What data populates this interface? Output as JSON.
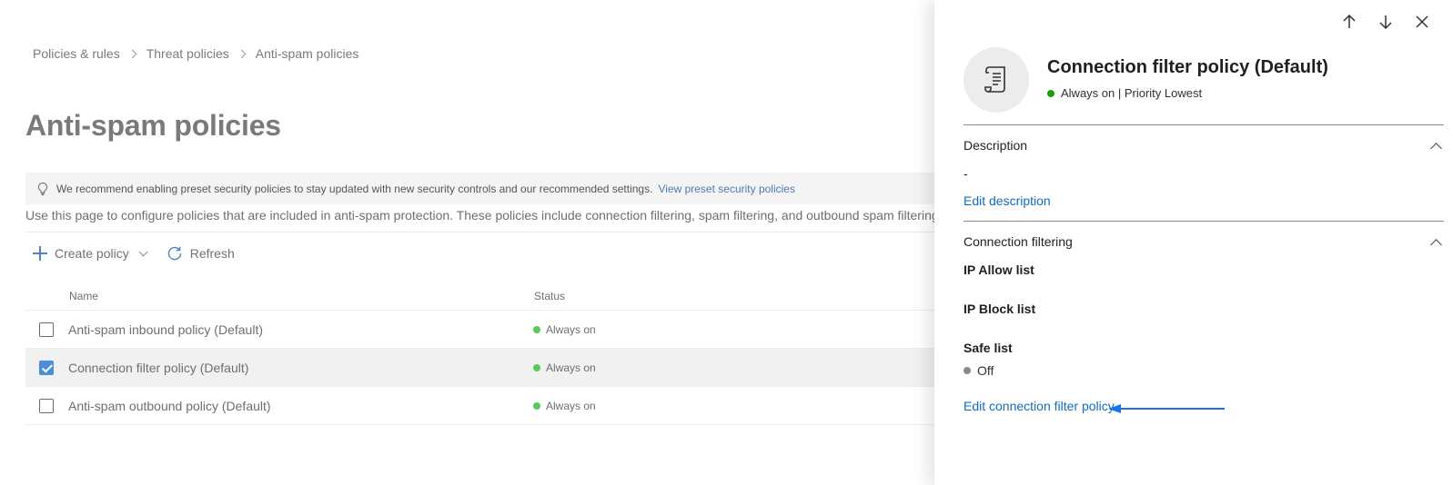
{
  "breadcrumb": {
    "items": [
      "Policies & rules",
      "Threat policies",
      "Anti-spam policies"
    ]
  },
  "page": {
    "title": "Anti-spam policies",
    "banner_text": "We recommend enabling preset security policies to stay updated with new security controls and our recommended settings.",
    "banner_link": "View preset security policies",
    "description": "Use this page to configure policies that are included in anti-spam protection. These policies include connection filtering, spam filtering, and outbound spam filtering.",
    "icons": [
      "lightbulb-icon",
      "plus-icon",
      "chevron-down-icon",
      "refresh-icon"
    ]
  },
  "toolbar": {
    "create_label": "Create policy",
    "refresh_label": "Refresh"
  },
  "table": {
    "columns": [
      "Name",
      "Status"
    ],
    "rows": [
      {
        "name": "Anti-spam inbound policy (Default)",
        "status": "Always on",
        "checked": false
      },
      {
        "name": "Connection filter policy (Default)",
        "status": "Always on",
        "checked": true
      },
      {
        "name": "Anti-spam outbound policy (Default)",
        "status": "Always on",
        "checked": false
      }
    ]
  },
  "panel": {
    "title": "Connection filter policy (Default)",
    "status_text": "Always on | Priority Lowest",
    "actions": [
      "arrow-up-icon",
      "arrow-down-icon",
      "close-icon"
    ],
    "description_section": {
      "heading": "Description",
      "value": "-",
      "edit_link": "Edit description"
    },
    "filtering_section": {
      "heading": "Connection filtering",
      "ip_allow_label": "IP Allow list",
      "ip_block_label": "IP Block list",
      "safe_list_label": "Safe list",
      "safe_list_value": "Off",
      "edit_link": "Edit connection filter policy"
    }
  },
  "colors": {
    "accent": "#0f6cbd",
    "status_green": "#13a10e",
    "annotation_arrow": "#1a73e8"
  }
}
